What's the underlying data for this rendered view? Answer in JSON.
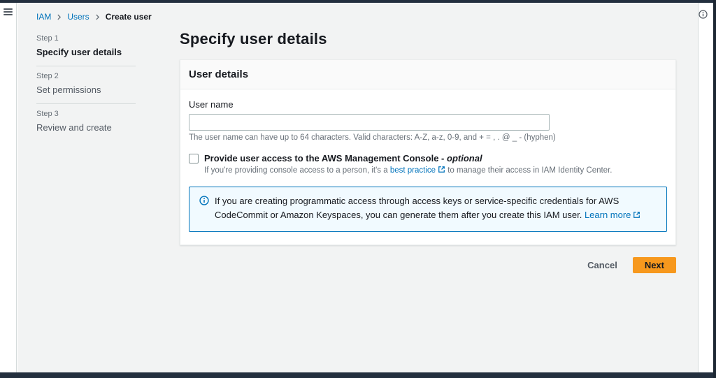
{
  "chrome": {
    "top_bar_color": "#232f3e",
    "rail_border_color": "#d5dbdb"
  },
  "breadcrumb": {
    "items": [
      {
        "label": "IAM"
      },
      {
        "label": "Users"
      },
      {
        "label": "Create user"
      }
    ]
  },
  "steps": {
    "items": [
      {
        "step": "Step 1",
        "title": "Specify user details",
        "active": true
      },
      {
        "step": "Step 2",
        "title": "Set permissions",
        "active": false
      },
      {
        "step": "Step 3",
        "title": "Review and create",
        "active": false
      }
    ]
  },
  "page": {
    "title": "Specify user details"
  },
  "card": {
    "title": "User details",
    "username": {
      "label": "User name",
      "value": "",
      "helper": "The user name can have up to 64 characters. Valid characters: A-Z, a-z, 0-9, and + = , . @ _ - (hyphen)"
    },
    "console_access": {
      "label": "Provide user access to the AWS Management Console - ",
      "optional_word": "optional",
      "helper_prefix": "If you're providing console access to a person, it's a ",
      "helper_link": "best practice",
      "helper_suffix": " to manage their access in IAM Identity Center."
    },
    "alert": {
      "text": "If you are creating programmatic access through access keys or service-specific credentials for AWS CodeCommit or Amazon Keyspaces, you can generate them after you create this IAM user. ",
      "link": "Learn more"
    }
  },
  "actions": {
    "cancel": "Cancel",
    "next": "Next"
  },
  "colors": {
    "accent_orange": "#f7981d",
    "link_blue": "#0073bb",
    "nav_dark": "#232f3e",
    "alert_bg": "#f1faff",
    "page_bg": "#f2f3f3"
  }
}
